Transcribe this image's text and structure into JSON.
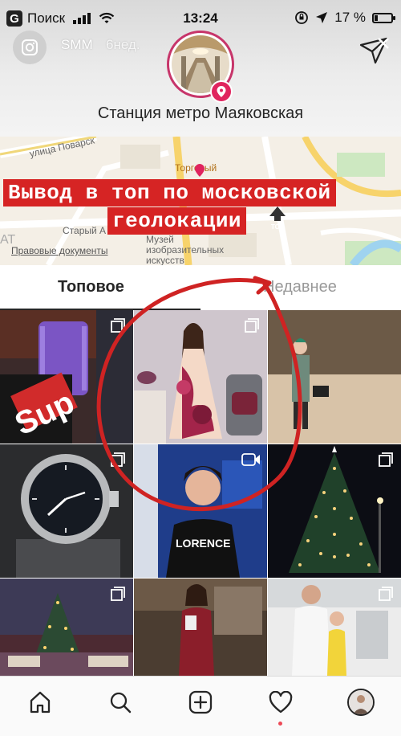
{
  "status_bar": {
    "carrier": "Поиск",
    "time": "13:24",
    "battery_percent": "17 %",
    "battery_level": 0.17
  },
  "story": {
    "username": "SMM",
    "age": "6нед."
  },
  "location": {
    "title": "Станция метро Маяковская"
  },
  "map": {
    "street_label": "улица Поварск",
    "old_arbat": "Старый А",
    "mall_label": "Торговый",
    "ak": "АТ",
    "terms_link": "Правовые документы",
    "museum_label_1": "Музей",
    "museum_label_2": "изобразительных",
    "museum_label_3": "искусств",
    "caption_line1": "Вывод в топ по московской",
    "caption_line2": "геолокации",
    "badge_text": "TOP"
  },
  "tabs": {
    "top": "Топовое",
    "recent": "Недавнее"
  },
  "grid": {
    "post_1_text": "Sup"
  },
  "tabbar": {
    "items": [
      "home-icon",
      "search-icon",
      "add-post-icon",
      "activity-icon",
      "profile"
    ]
  },
  "colors": {
    "accent_red": "#d62424",
    "story_ring": "#c7356a",
    "notification_dot": "#ed4956"
  }
}
